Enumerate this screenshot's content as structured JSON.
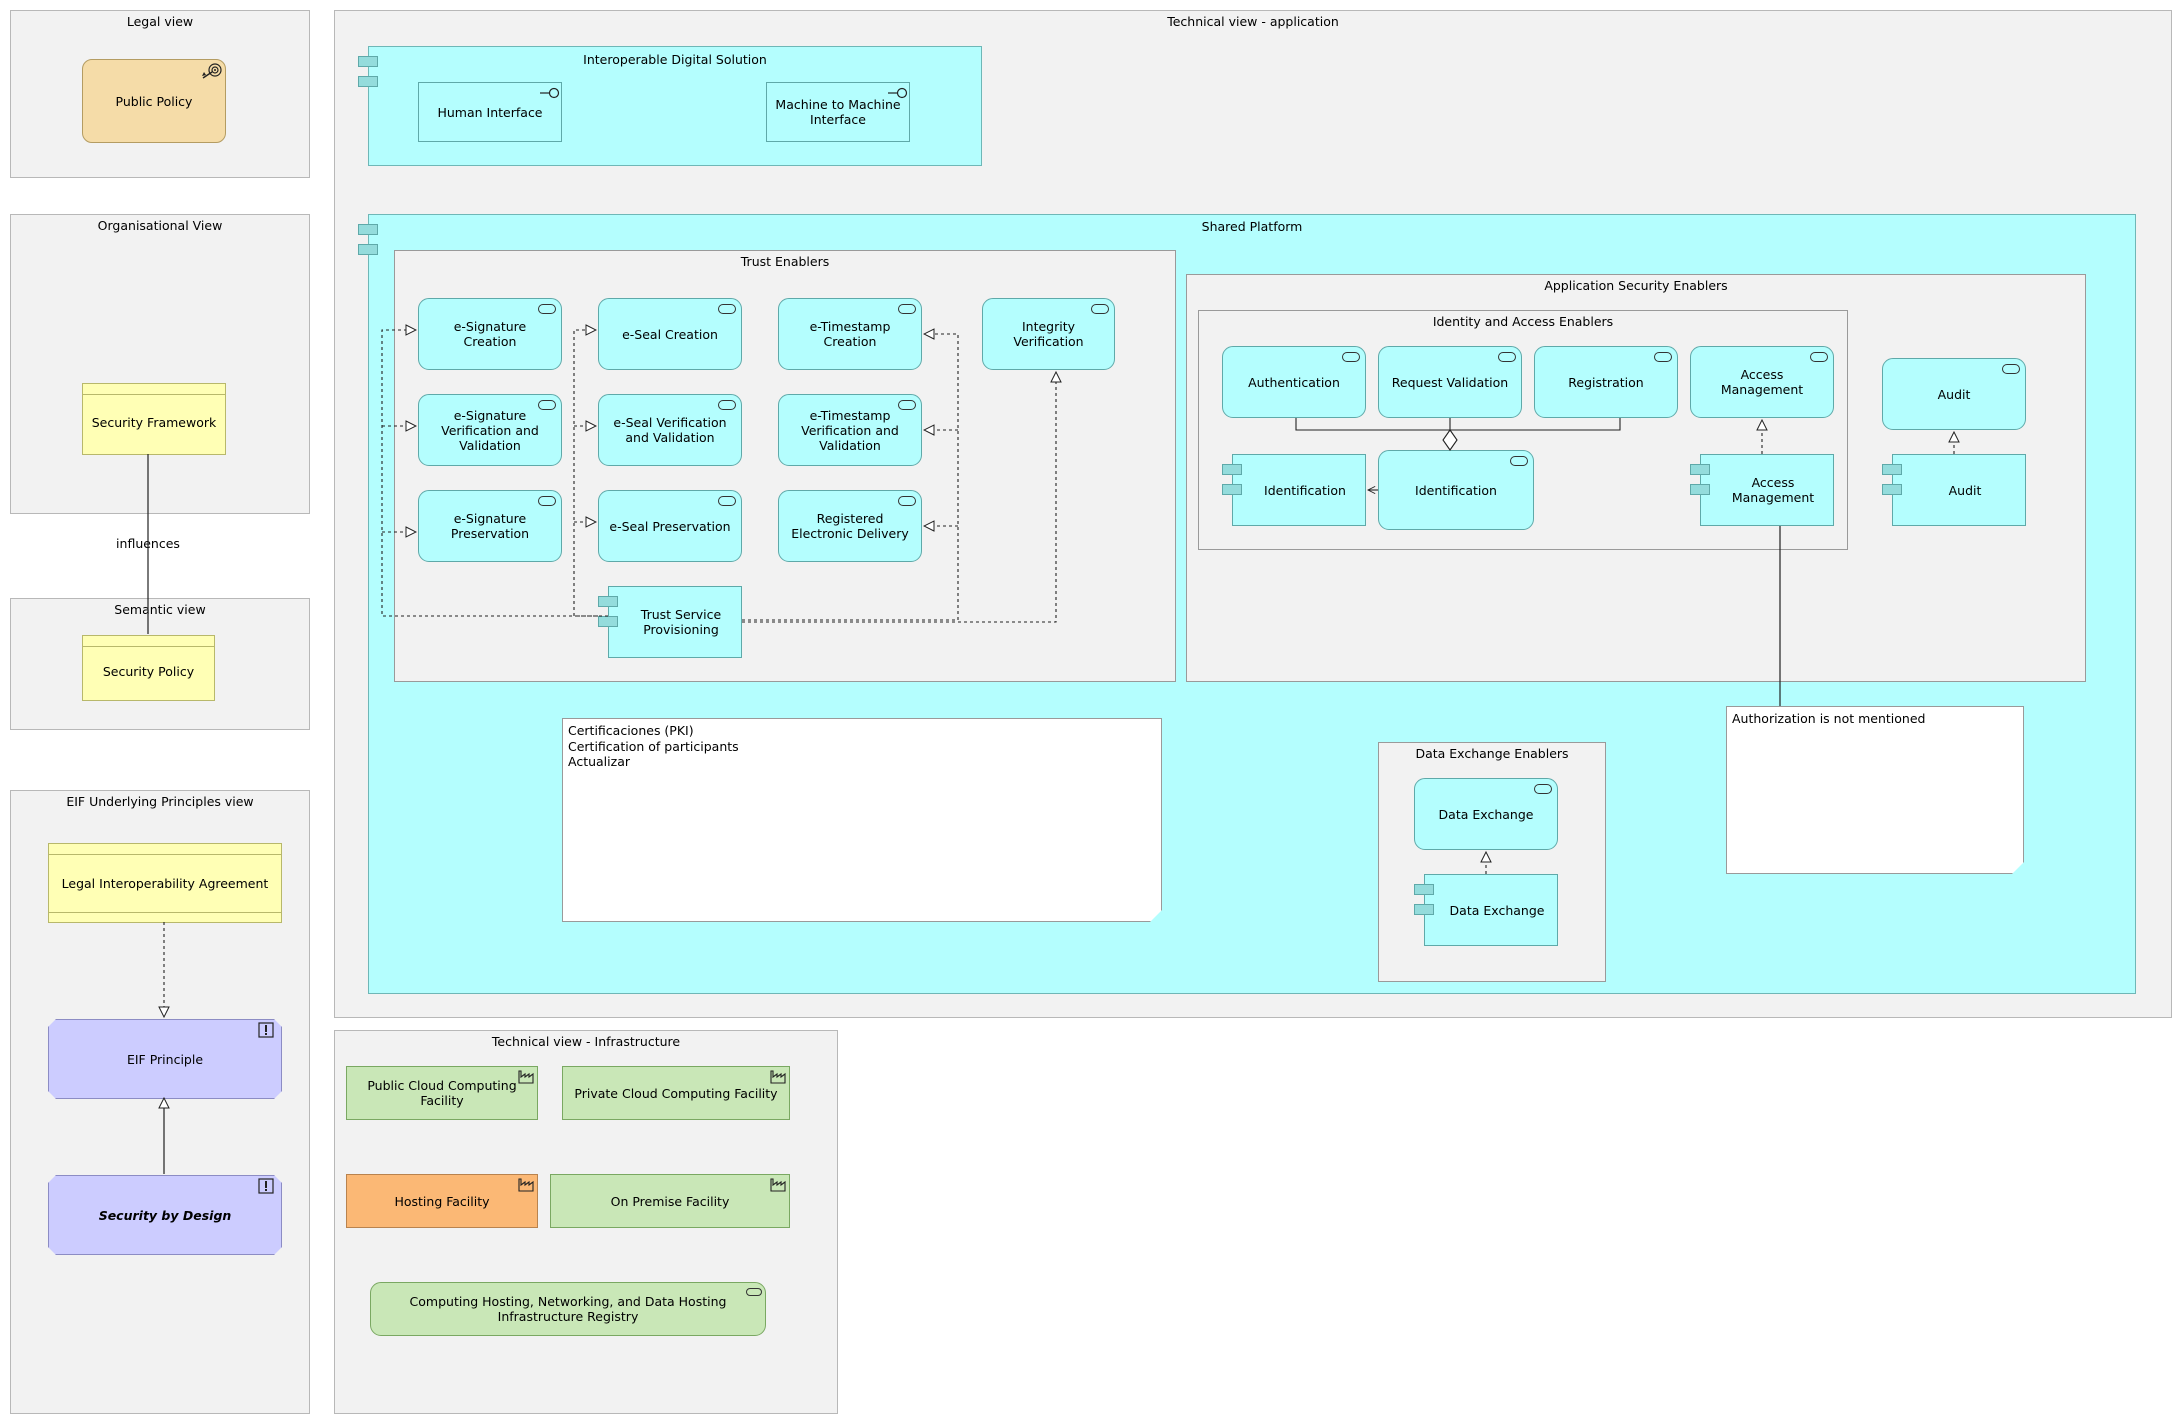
{
  "groups": {
    "legal": "Legal view",
    "organisational": "Organisational View",
    "semantic": "Semantic view",
    "eif": "EIF Underlying Principles view",
    "tech_app": "Technical view - application",
    "tech_infra": "Technical view - Infrastructure"
  },
  "legal": {
    "public_policy": "Public Policy"
  },
  "organisational": {
    "security_framework": "Security Framework",
    "influences": "influences"
  },
  "semantic": {
    "security_policy": "Security Policy"
  },
  "eif": {
    "agreement": "Legal Interoperability Agreement",
    "principle": "EIF Principle",
    "security_by_design": "Security by Design"
  },
  "ids": {
    "title": "Interoperable Digital Solution",
    "human_interface": "Human Interface",
    "m2m_interface": "Machine to Machine Interface"
  },
  "shared": {
    "title": "Shared Platform",
    "trust": {
      "title": "Trust Enablers",
      "esig_creation": "e-Signature Creation",
      "eseal_creation": "e-Seal Creation",
      "etimestamp_creation": "e-Timestamp Creation",
      "integrity_verification": "Integrity Verification",
      "esig_verification": "e-Signature Verification and Validation",
      "eseal_verification": "e-Seal Verification and Validation",
      "etimestamp_verification": "e-Timestamp Verification and Validation",
      "esig_preservation": "e-Signature Preservation",
      "eseal_preservation": "e-Seal Preservation",
      "registered_delivery": "Registered Electronic Delivery",
      "trust_provisioning": "Trust Service Provisioning"
    },
    "ase": {
      "title": "Application Security Enablers",
      "iam_title": "Identity and Access Enablers",
      "authentication": "Authentication",
      "request_validation": "Request Validation",
      "registration": "Registration",
      "access_management_svc": "Access Management",
      "identification_comp": "Identification",
      "identification_svc": "Identification",
      "access_management_comp": "Access Management",
      "audit_svc": "Audit",
      "audit_comp": "Audit"
    },
    "note_pki": [
      "Certificaciones (PKI)",
      "Certification of participants",
      "Actualizar"
    ],
    "dee": {
      "title": "Data Exchange Enablers",
      "data_exchange_svc": "Data Exchange",
      "data_exchange_comp": "Data Exchange"
    },
    "note_auth": "Authorization is not mentioned"
  },
  "infra": {
    "public_cloud": "Public Cloud Computing Facility",
    "private_cloud": "Private Cloud Computing Facility",
    "hosting": "Hosting Facility",
    "on_premise": "On Premise Facility",
    "registry": "Computing Hosting, Networking, and Data Hosting Infrastructure Registry"
  },
  "colors": {
    "application": "#b4fefe",
    "business_object": "#ffffb5",
    "technology": "#c9e7b7",
    "principle": "#ccccff",
    "motivation": "#f5dca8",
    "hosting": "#fbb875",
    "group": "#f2f2f2"
  }
}
